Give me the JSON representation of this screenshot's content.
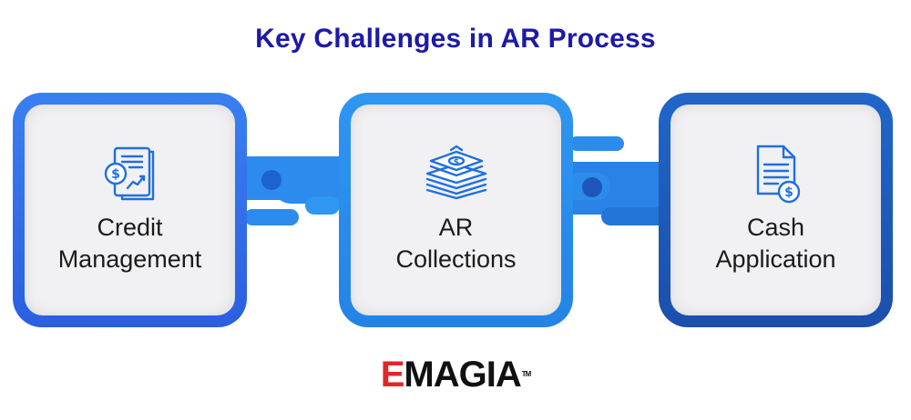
{
  "title": "Key Challenges in AR Process",
  "cards": [
    {
      "line1": "Credit",
      "line2": "Management",
      "icon": "credit-report-icon"
    },
    {
      "line1": "AR",
      "line2": "Collections",
      "icon": "money-stack-icon"
    },
    {
      "line1": "Cash",
      "line2": "Application",
      "icon": "invoice-dollar-icon"
    }
  ],
  "logo": {
    "first": "E",
    "rest": "MAGIA",
    "tm": "TM"
  },
  "colors": {
    "title": "#1d1aa8",
    "card1": "#3a7ff2",
    "card2": "#2f96f2",
    "card3": "#2166c9",
    "icon": "#1f6fe0",
    "logo_accent": "#e32626"
  }
}
